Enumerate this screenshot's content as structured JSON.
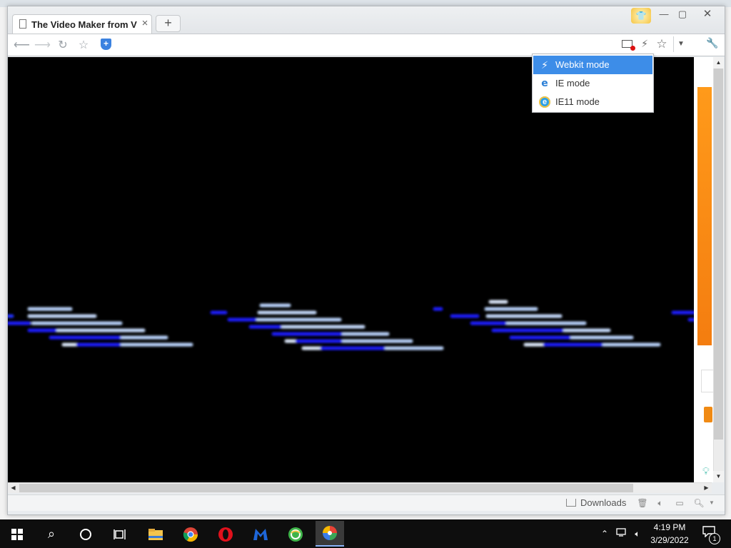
{
  "window": {
    "tab_title": "The Video Maker from V",
    "tab_close": "×",
    "new_tab": "+",
    "minimize": "—",
    "maximize": "▢",
    "close": "✕"
  },
  "toolbar": {
    "back": "⟵",
    "forward": "⟶",
    "reload": "↻",
    "favorite": "☆",
    "star": "☆",
    "dropdown": "▼",
    "tools": "🔧"
  },
  "mode_menu": {
    "items": [
      {
        "label": "Webkit mode",
        "icon": "lightning-icon",
        "selected": true
      },
      {
        "label": "IE mode",
        "icon": "ie-icon",
        "selected": false
      },
      {
        "label": "IE11 mode",
        "icon": "ie11-icon",
        "selected": false
      }
    ]
  },
  "statusbar": {
    "downloads": "Downloads"
  },
  "taskbar": {
    "time": "4:19 PM",
    "date": "3/29/2022",
    "notification_count": "1",
    "apps": [
      "start",
      "search",
      "cortana",
      "task-view",
      "file-explorer",
      "chrome",
      "opera",
      "malwarebytes",
      "360-browser",
      "video-maker"
    ]
  },
  "colors": {
    "accent": "#3d8de8",
    "video_background": "#000000",
    "bar_blue": "#1a1aff",
    "bar_light": "#bcd6ff",
    "side_orange": "#f47d10"
  }
}
